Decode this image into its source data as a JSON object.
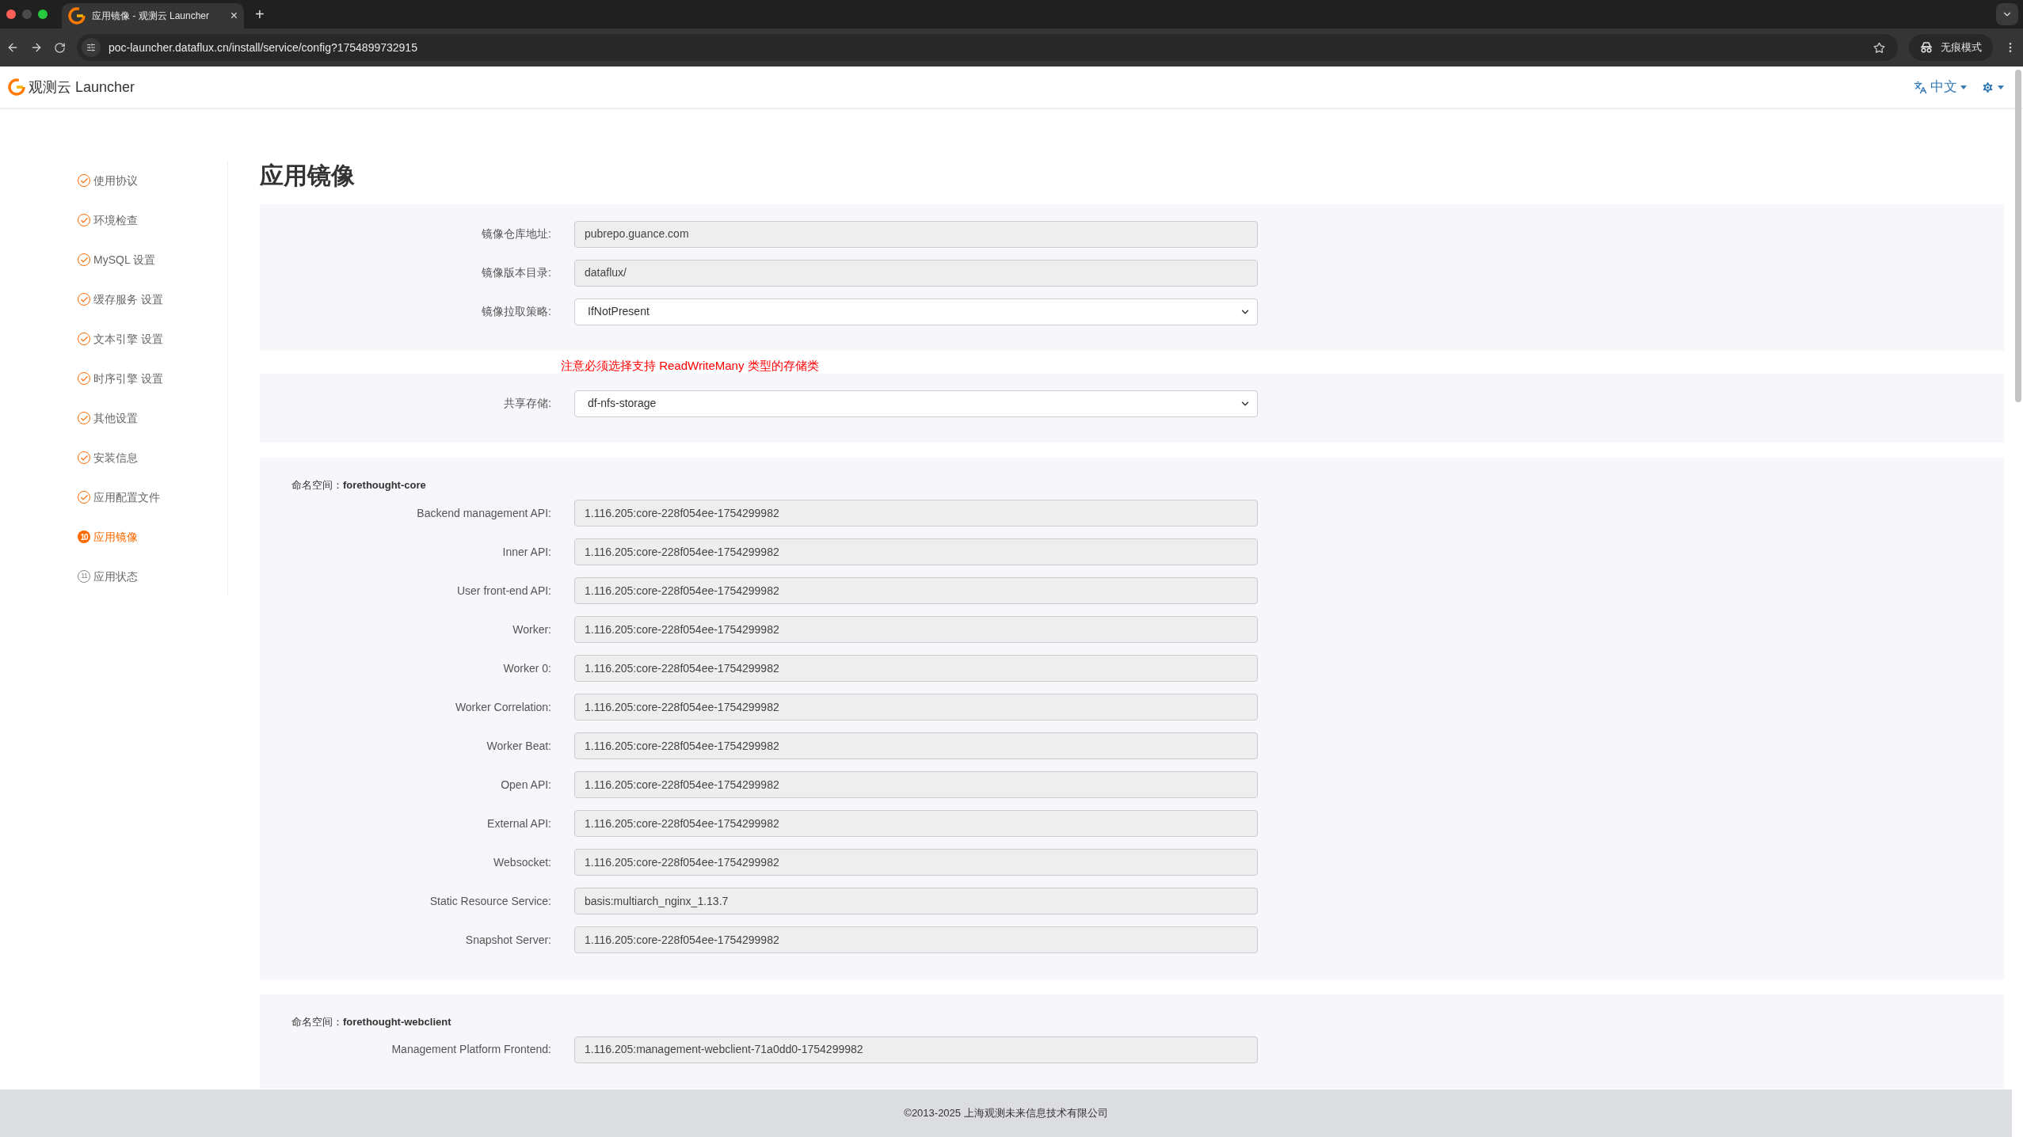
{
  "browser": {
    "tab_title": "应用镜像 - 观测云 Launcher",
    "tab_close": "×",
    "new_tab": "+",
    "url": "poc-launcher.dataflux.cn/install/service/config?1754899732915",
    "incognito": "无痕模式"
  },
  "header": {
    "brand": "观测云 Launcher",
    "language": "中文"
  },
  "sidebar": {
    "items": [
      {
        "label": "使用协议",
        "kind": "done",
        "selected": false
      },
      {
        "label": "环境检查",
        "kind": "done",
        "selected": false
      },
      {
        "label": "MySQL 设置",
        "kind": "done",
        "selected": false
      },
      {
        "label": "缓存服务 设置",
        "kind": "done",
        "selected": false
      },
      {
        "label": "文本引擎 设置",
        "kind": "done",
        "selected": false
      },
      {
        "label": "时序引擎 设置",
        "kind": "done",
        "selected": false
      },
      {
        "label": "其他设置",
        "kind": "done",
        "selected": false
      },
      {
        "label": "安装信息",
        "kind": "done",
        "selected": false
      },
      {
        "label": "应用配置文件",
        "kind": "done",
        "selected": false
      },
      {
        "label": "应用镜像",
        "kind": "numbered",
        "number": "10",
        "selected": true
      },
      {
        "label": "应用状态",
        "kind": "numbered",
        "number": "11",
        "selected": false
      }
    ]
  },
  "page_title": "应用镜像",
  "sections": [
    {
      "fields": [
        {
          "label": "镜像仓库地址:",
          "kind": "text",
          "value": "pubrepo.guance.com"
        },
        {
          "label": "镜像版本目录:",
          "kind": "text",
          "value": "dataflux/"
        },
        {
          "label": "镜像拉取策略:",
          "kind": "select",
          "value": "IfNotPresent"
        }
      ]
    },
    {
      "notice": "注意必须选择支持 ReadWriteMany 类型的存储类",
      "fields": [
        {
          "label": "共享存储:",
          "kind": "select",
          "value": "df-nfs-storage"
        }
      ]
    },
    {
      "namespace_label": "命名空间：",
      "namespace": "forethought-core",
      "fields": [
        {
          "label": "Backend management API:",
          "kind": "text",
          "value": "1.116.205:core-228f054ee-1754299982"
        },
        {
          "label": "Inner API:",
          "kind": "text",
          "value": "1.116.205:core-228f054ee-1754299982"
        },
        {
          "label": "User front-end API:",
          "kind": "text",
          "value": "1.116.205:core-228f054ee-1754299982"
        },
        {
          "label": "Worker:",
          "kind": "text",
          "value": "1.116.205:core-228f054ee-1754299982"
        },
        {
          "label": "Worker 0:",
          "kind": "text",
          "value": "1.116.205:core-228f054ee-1754299982"
        },
        {
          "label": "Worker Correlation:",
          "kind": "text",
          "value": "1.116.205:core-228f054ee-1754299982"
        },
        {
          "label": "Worker Beat:",
          "kind": "text",
          "value": "1.116.205:core-228f054ee-1754299982"
        },
        {
          "label": "Open API:",
          "kind": "text",
          "value": "1.116.205:core-228f054ee-1754299982"
        },
        {
          "label": "External API:",
          "kind": "text",
          "value": "1.116.205:core-228f054ee-1754299982"
        },
        {
          "label": "Websocket:",
          "kind": "text",
          "value": "1.116.205:core-228f054ee-1754299982"
        },
        {
          "label": "Static Resource Service:",
          "kind": "text",
          "value": "basis:multiarch_nginx_1.13.7"
        },
        {
          "label": "Snapshot Server:",
          "kind": "text",
          "value": "1.116.205:core-228f054ee-1754299982"
        }
      ]
    },
    {
      "namespace_label": "命名空间：",
      "namespace": "forethought-webclient",
      "fields": [
        {
          "label": "Management Platform Frontend:",
          "kind": "text",
          "value": "1.116.205:management-webclient-71a0dd0-1754299982"
        }
      ]
    }
  ],
  "footer": "©2013-2025 上海观测未来信息技术有限公司"
}
